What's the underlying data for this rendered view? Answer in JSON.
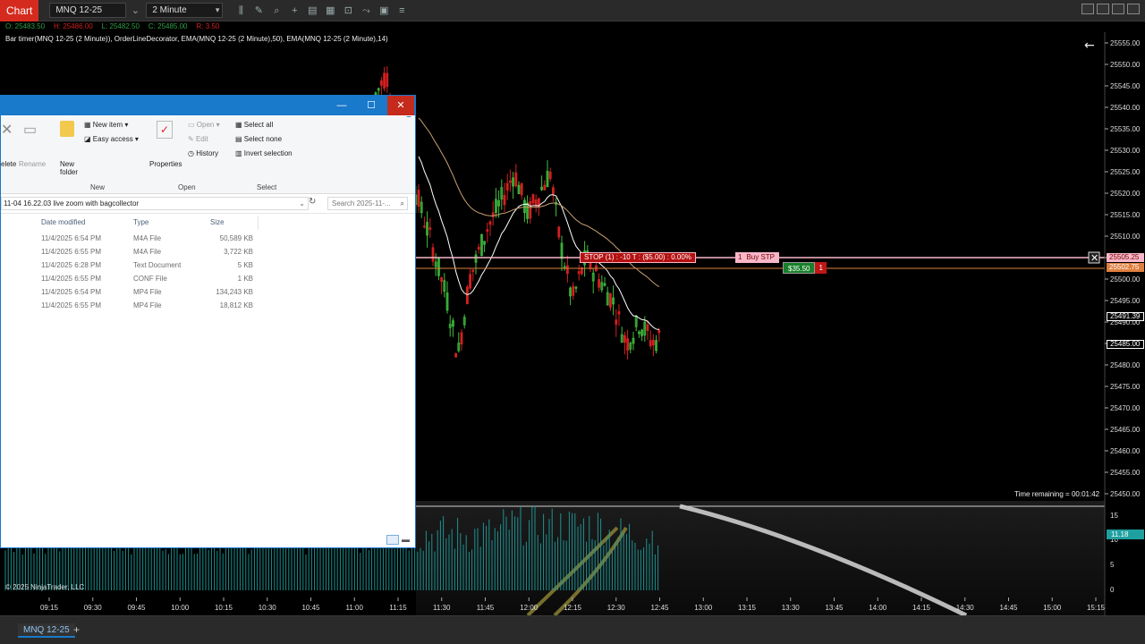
{
  "toolbar": {
    "chart_tab": "Chart",
    "instrument": "MNQ 12-25",
    "interval": "2 Minute"
  },
  "ohlc": {
    "open": "O: 25483.50",
    "high": "H: 25486.00",
    "low": "L: 25482.50",
    "close": "C: 25485.00",
    "range": "R: 3.50"
  },
  "indicators_label": "Bar timer(MNQ 12-25 (2 Minute)), OrderLineDecorator, EMA(MNQ 12-25 (2 Minute),50), EMA(MNQ 12-25 (2 Minute),14)",
  "price_axis": [
    "25555.00",
    "25550.00",
    "25545.00",
    "25540.00",
    "25535.00",
    "25530.00",
    "25525.00",
    "25520.00",
    "25515.00",
    "25510.00",
    "25505.00",
    "25500.00",
    "25495.00",
    "25490.00",
    "25485.00",
    "25480.00",
    "25475.00",
    "25470.00",
    "25465.00",
    "25460.00",
    "25455.00",
    "25450.00"
  ],
  "price_tags": {
    "stop_upper": "25505.25",
    "stop_lower": "25502.75",
    "mid": "25491.39",
    "last": "25485.00"
  },
  "volume_axis": [
    "15",
    "10",
    "5",
    "0"
  ],
  "volume_tag": "11.18",
  "time_axis": [
    "09:15",
    "09:30",
    "09:45",
    "10:00",
    "10:15",
    "10:30",
    "10:45",
    "11:00",
    "11:15",
    "11:30",
    "11:45",
    "12:00",
    "12:15",
    "12:30",
    "12:45",
    "13:00",
    "13:15",
    "13:30",
    "13:45",
    "14:00",
    "14:15",
    "14:30",
    "14:45",
    "15:00",
    "15:15"
  ],
  "orders": {
    "stop_label": "STOP (1)  :  -10 T  :  ($5.00)  :  0.00%",
    "buy_stp_qty": "1",
    "buy_stp_label": "Buy STP",
    "pnl_value": "$35.50",
    "pnl_qty": "1"
  },
  "time_remaining": "Time remaining = 00:01:42",
  "copyright": "© 2025 NinjaTrader, LLC",
  "bottom_tab": "MNQ 12-25",
  "explorer": {
    "ribbon": {
      "delete": "elete",
      "rename": "Rename",
      "new_folder": "New folder",
      "new_item": "New item",
      "easy_access": "Easy access",
      "properties": "Properties",
      "open": "Open",
      "edit": "Edit",
      "history": "History",
      "select_all": "Select all",
      "select_none": "Select none",
      "invert_selection": "Invert selection",
      "group_new": "New",
      "group_open": "Open",
      "group_select": "Select"
    },
    "address": "11-04 16.22.03 live zoom with bagcollector",
    "search_placeholder": "Search 2025-11-...",
    "columns": {
      "date": "Date modified",
      "type": "Type",
      "size": "Size"
    },
    "files": [
      {
        "date": "11/4/2025 6:54 PM",
        "type": "M4A File",
        "size": "50,589 KB"
      },
      {
        "date": "11/4/2025 6:55 PM",
        "type": "M4A File",
        "size": "3,722 KB"
      },
      {
        "date": "11/4/2025 6:28 PM",
        "type": "Text Document",
        "size": "5 KB"
      },
      {
        "date": "11/4/2025 6:55 PM",
        "type": "CONF File",
        "size": "1 KB"
      },
      {
        "date": "11/4/2025 6:54 PM",
        "type": "MP4 File",
        "size": "134,243 KB"
      },
      {
        "date": "11/4/2025 6:55 PM",
        "type": "MP4 File",
        "size": "18,812 KB"
      }
    ]
  },
  "colors": {
    "up_candle": "#3fbf3f",
    "down_candle": "#d42020",
    "ema_fast": "#ffffff",
    "ema_slow": "#c8a070",
    "volume": "#1fa0a0",
    "explorer_accent": "#1979ca",
    "chart_tab": "#d52b1e"
  }
}
